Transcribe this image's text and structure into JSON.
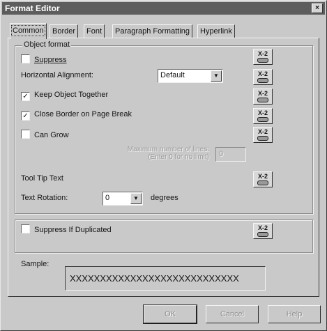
{
  "window": {
    "title": "Format Editor",
    "close_label": "×"
  },
  "tabs": [
    {
      "label": "Common"
    },
    {
      "label": "Border"
    },
    {
      "label": "Font"
    },
    {
      "label": "Paragraph Formatting"
    },
    {
      "label": "Hyperlink"
    }
  ],
  "object_format": {
    "group_label": "Object format",
    "suppress": {
      "label": "Suppress",
      "checked": false
    },
    "horizontal_alignment": {
      "label": "Horizontal Alignment:",
      "value": "Default"
    },
    "keep_together": {
      "label": "Keep Object Together",
      "checked": true
    },
    "close_border": {
      "label": "Close Border on Page Break",
      "checked": true
    },
    "can_grow": {
      "label": "Can Grow",
      "checked": false
    },
    "max_lines": {
      "label_line1": "Maximum number of lines:",
      "label_line2": "(Enter 0 for no limit)",
      "value": "0"
    },
    "tooltip": {
      "label": "Tool Tip Text"
    },
    "rotation": {
      "label": "Text Rotation:",
      "value": "0",
      "unit": "degrees"
    }
  },
  "suppress_dup": {
    "label": "Suppress If Duplicated",
    "checked": false
  },
  "formula_button": {
    "top": "X-2",
    "icon": "formula-pencil-icon"
  },
  "sample": {
    "label": "Sample:",
    "text": "XXXXXXXXXXXXXXXXXXXXXXXXXXXX"
  },
  "buttons": {
    "ok": "OK",
    "cancel": "Cancel",
    "help": "Help"
  },
  "check_mark": "✓",
  "dropdown_arrow": "▼"
}
